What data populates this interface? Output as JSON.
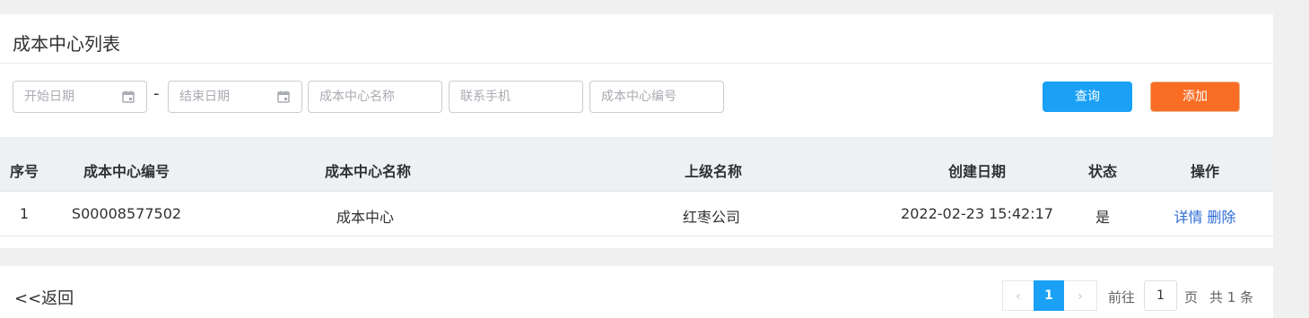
{
  "page": {
    "title": "成本中心列表"
  },
  "filters": {
    "start_date_placeholder": "开始日期",
    "range_separator": "-",
    "end_date_placeholder": "结束日期",
    "cost_center_name_placeholder": "成本中心名称",
    "contact_phone_placeholder": "联系手机",
    "cost_center_code_placeholder": "成本中心编号"
  },
  "buttons": {
    "query": "查询",
    "add": "添加"
  },
  "table": {
    "columns": [
      "序号",
      "成本中心编号",
      "成本中心名称",
      "上级名称",
      "创建日期",
      "状态",
      "操作"
    ],
    "rows": [
      {
        "index": "1",
        "code": "S00008577502",
        "name": "成本中心",
        "parent": "红枣公司",
        "created": "2022-02-23 15:42:17",
        "status": "是",
        "action_detail": "详情",
        "action_delete": "删除"
      }
    ]
  },
  "footer": {
    "back": "<<返回",
    "pagination": {
      "prev_icon": "‹",
      "current_page": "1",
      "next_icon": "›",
      "goto_label": "前往",
      "goto_value": "1",
      "page_unit": "页",
      "total_text": "共 1 条"
    }
  },
  "colors": {
    "primary": "#1aa1f5",
    "add": "#fa6d24",
    "link": "#2e6bd6"
  }
}
